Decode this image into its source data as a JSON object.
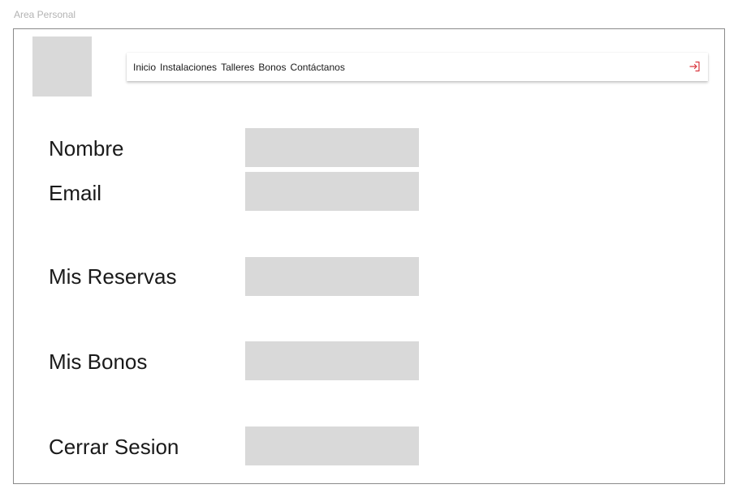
{
  "page_label": "Area Personal",
  "nav": {
    "items": [
      {
        "label": "Inicio"
      },
      {
        "label": "Instalaciones"
      },
      {
        "label": "Talleres"
      },
      {
        "label": "Bonos"
      },
      {
        "label": "Contáctanos"
      }
    ],
    "logout_icon": "logout-icon",
    "logout_color": "#d9363e"
  },
  "rows": [
    {
      "label": "Nombre"
    },
    {
      "label": "Email"
    },
    {
      "label": "Mis Reservas"
    },
    {
      "label": "Mis Bonos"
    },
    {
      "label": "Cerrar Sesion"
    }
  ],
  "colors": {
    "placeholder": "#d9d9d9",
    "frame_border": "#8a8a8a"
  }
}
